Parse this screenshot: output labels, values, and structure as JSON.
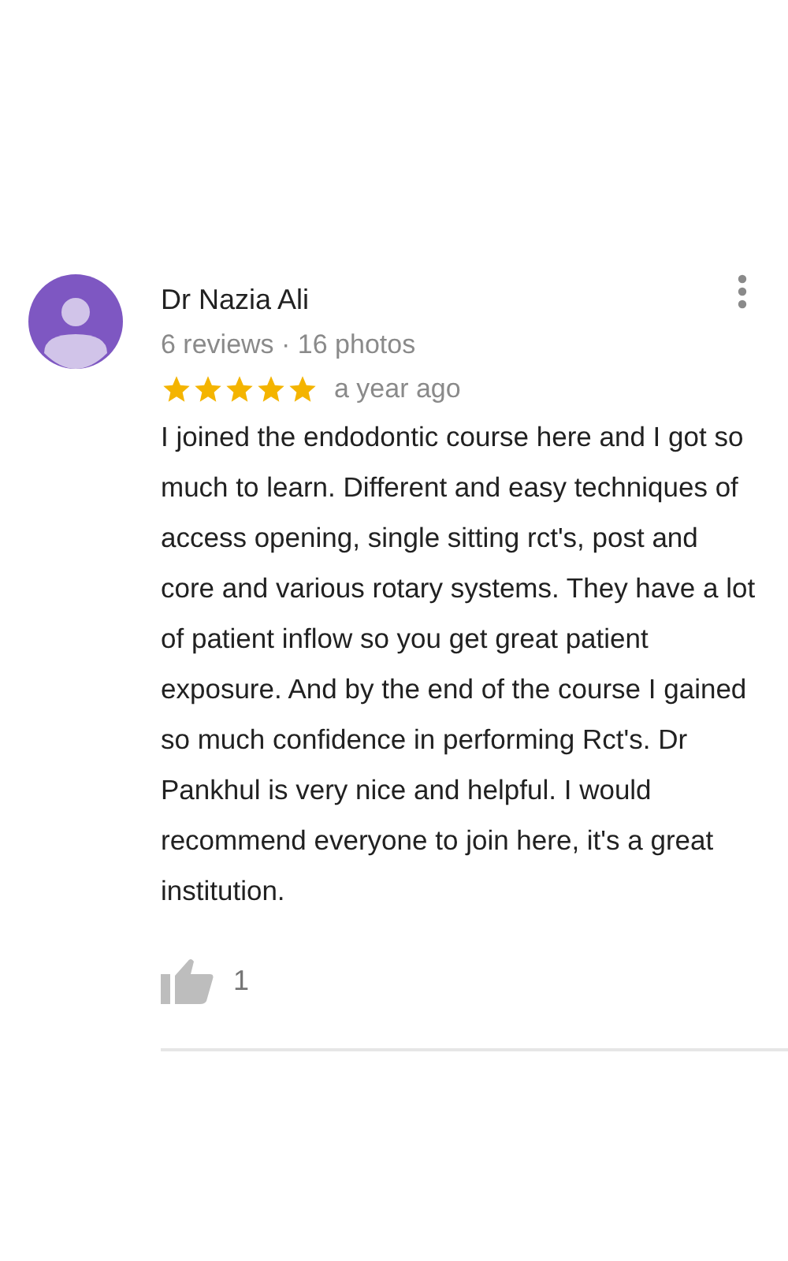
{
  "review": {
    "author": "Dr Nazia Ali",
    "meta": "6 reviews · 16 photos",
    "stars": 5,
    "time": "a year ago",
    "text": "I joined the endodontic course here and I got so much to learn. Different and easy techniques of access opening, single sitting rct's, post and core and various rotary systems. They have a lot of patient inflow so you get great patient exposure. And by the end of the course I gained so much confidence in performing Rct's. Dr Pankhul is very nice and helpful. I would recommend everyone to join here, it's a great institution.",
    "likes": "1"
  }
}
